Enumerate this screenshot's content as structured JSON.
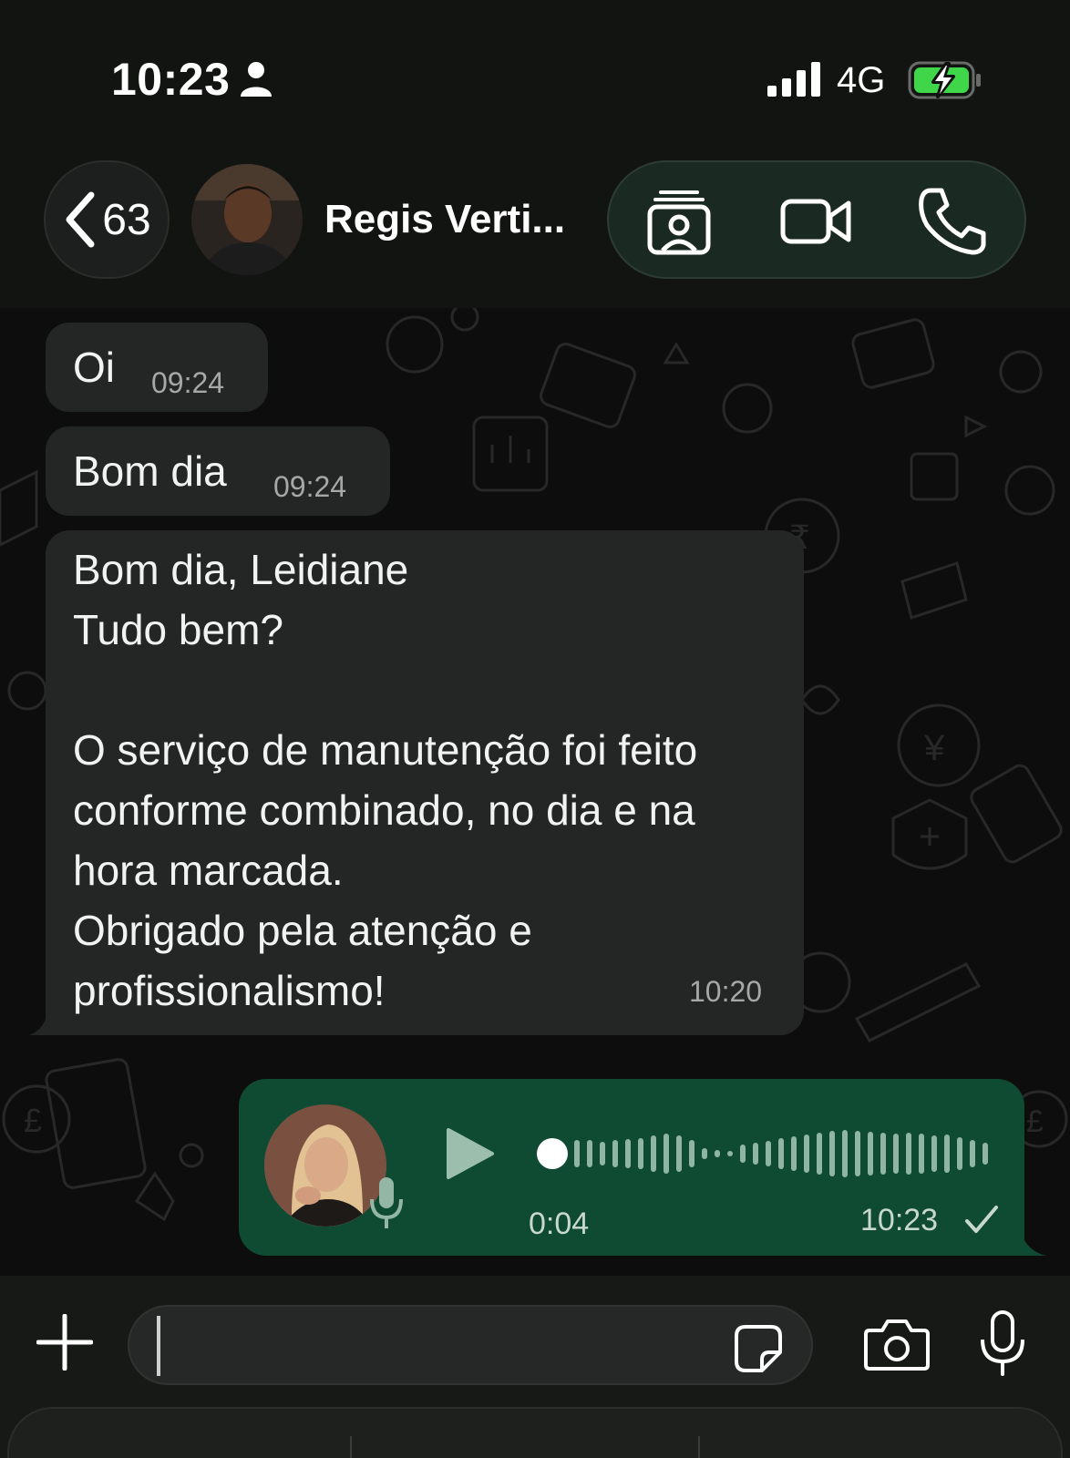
{
  "status_bar": {
    "time": "10:23",
    "network": "4G",
    "icons": [
      "person-icon",
      "signal-icon",
      "battery-charging-icon"
    ]
  },
  "header": {
    "back_count": "63",
    "contact_name": "Regis Verti...",
    "actions": [
      "contact-card-icon",
      "video-call-icon",
      "phone-icon"
    ]
  },
  "messages": [
    {
      "direction": "incoming",
      "text": "Oi",
      "time": "09:24"
    },
    {
      "direction": "incoming",
      "text": "Bom dia",
      "time": "09:24"
    },
    {
      "direction": "incoming",
      "text": "Bom dia, Leidiane\nTudo bem?\n\nO serviço de manutenção foi feito conforme combinado, no dia e na hora marcada.\nObrigado pela atenção e profissionalismo!",
      "time": "10:20"
    }
  ],
  "voice_message": {
    "direction": "outgoing",
    "duration": "0:04",
    "time": "10:23",
    "status": "sent"
  },
  "composer": {
    "placeholder": "",
    "icons": [
      "plus-icon",
      "sticker-icon",
      "camera-icon",
      "microphone-icon"
    ]
  },
  "colors": {
    "incoming_bubble": "#242626",
    "outgoing_bubble": "#0f4a33",
    "background": "#0c0d0c",
    "accent_green": "#3fd64a"
  }
}
